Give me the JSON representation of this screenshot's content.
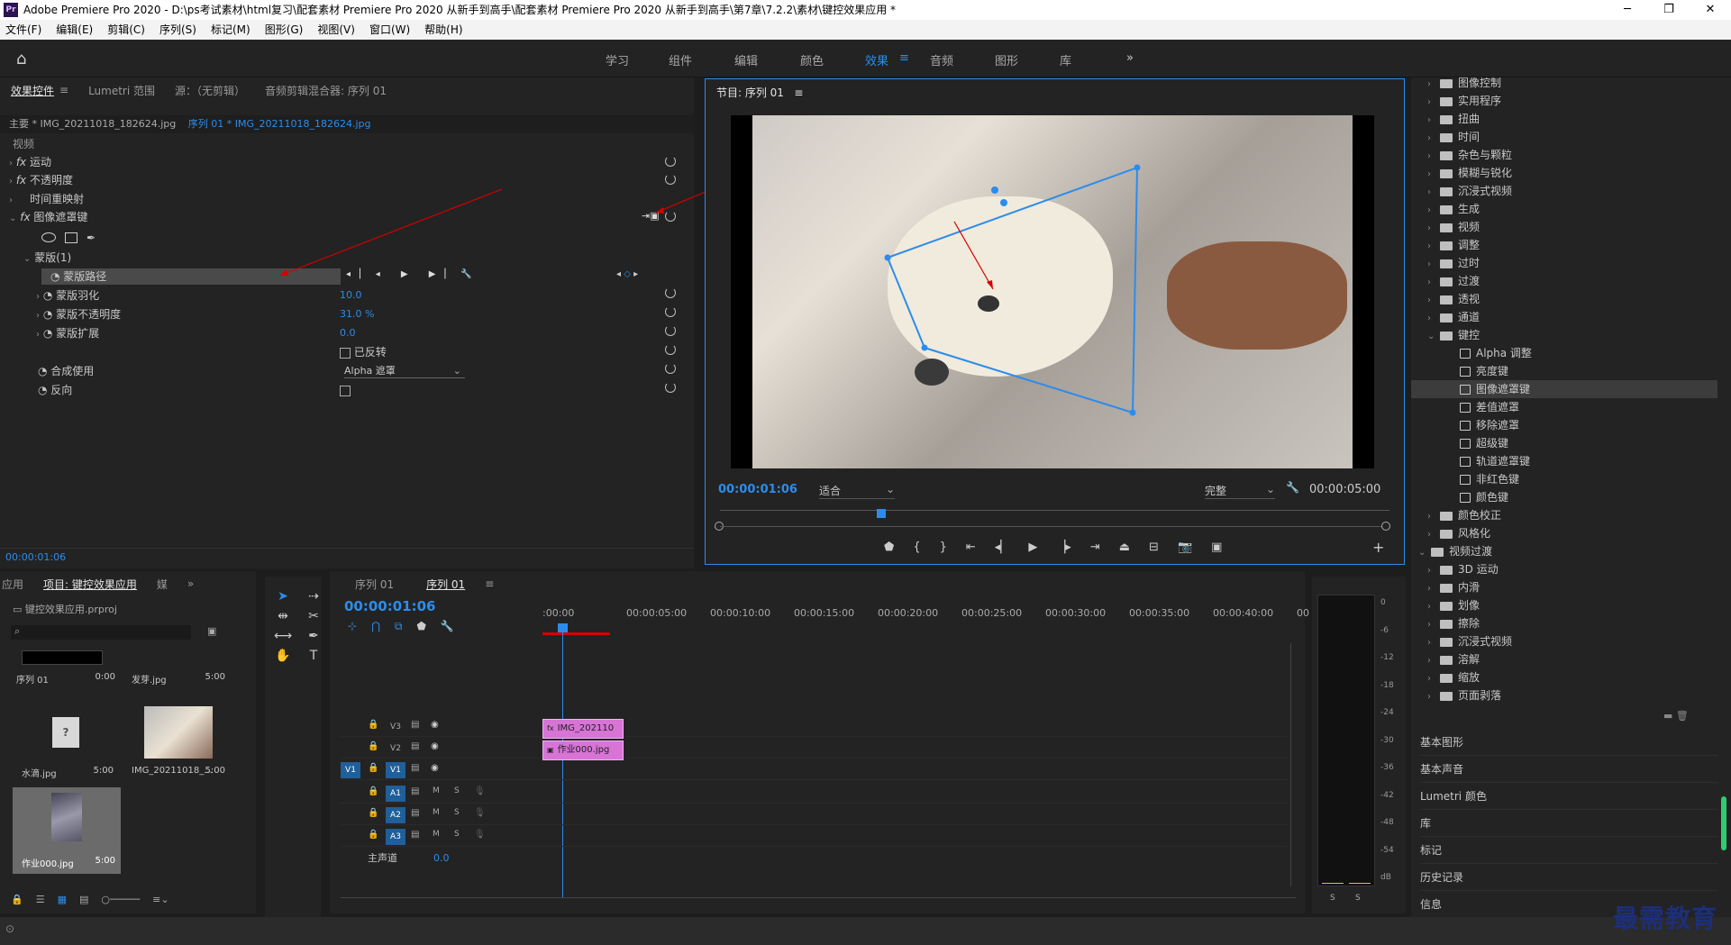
{
  "window": {
    "title": "Adobe Premiere Pro 2020 - D:\\ps考试素材\\html复习\\配套素材 Premiere Pro 2020 从新手到高手\\配套素材 Premiere Pro 2020 从新手到高手\\第7章\\7.2.2\\素材\\键控效果应用 *",
    "app_icon": "Pr",
    "minimize": "─",
    "maximize": "❐",
    "close": "✕"
  },
  "menu": [
    "文件(F)",
    "编辑(E)",
    "剪辑(C)",
    "序列(S)",
    "标记(M)",
    "图形(G)",
    "视图(V)",
    "窗口(W)",
    "帮助(H)"
  ],
  "workspaces": [
    "学习",
    "组件",
    "编辑",
    "颜色",
    "效果",
    "音频",
    "图形",
    "库"
  ],
  "active_workspace": "效果",
  "effect_controls": {
    "tabs": [
      "效果控件",
      "Lumetri 范围",
      "源：（无剪辑）",
      "音频剪辑混合器: 序列 01"
    ],
    "master": "主要 * IMG_20211018_182624.jpg",
    "sequence": "序列 01 * IMG_20211018_182624.jpg",
    "section": "视频",
    "rows": [
      "运动",
      "不透明度",
      "时间重映射",
      "图像遮罩键"
    ],
    "mask": "蒙版(1)",
    "mask_path": "蒙版路径",
    "mask_feather": "蒙版羽化",
    "feather_val": "10.0",
    "mask_opacity": "蒙版不透明度",
    "opacity_val": "31.0 %",
    "mask_expand": "蒙版扩展",
    "expand_val": "0.0",
    "inverted": "已反转",
    "composite": "合成使用",
    "composite_val": "Alpha 遮罩",
    "reverse": "反向",
    "timecode": "00:00:01:06"
  },
  "program": {
    "title": "节目: 序列 01",
    "timecode": "00:00:01:06",
    "fit": "适合",
    "quality": "完整",
    "duration": "00:00:05:00"
  },
  "effects_tree": {
    "items": [
      "图像控制",
      "实用程序",
      "扭曲",
      "时间",
      "杂色与颗粒",
      "模糊与锐化",
      "沉浸式视频",
      "生成",
      "视频",
      "调整",
      "过时",
      "过渡",
      "透视",
      "通道",
      "键控"
    ],
    "keying": [
      "Alpha 调整",
      "亮度键",
      "图像遮罩键",
      "差值遮罩",
      "移除遮罩",
      "超级键",
      "轨道遮罩键",
      "非红色键",
      "颜色键"
    ],
    "after": [
      "颜色校正",
      "风格化"
    ],
    "transitions": "视频过渡",
    "trans_items": [
      "3D 运动",
      "内滑",
      "划像",
      "擦除",
      "沉浸式视频",
      "溶解",
      "缩放",
      "页面剥落"
    ]
  },
  "right_bottom": [
    "基本图形",
    "基本声音",
    "Lumetri 颜色",
    "库",
    "标记",
    "历史记录",
    "信息"
  ],
  "project": {
    "tabs": [
      "应用",
      "项目: 键控效果应用",
      "媒"
    ],
    "file": "键控效果应用.prproj",
    "items": [
      {
        "name": "序列 01",
        "dur": "0:00"
      },
      {
        "name": "发芽.jpg",
        "dur": "5:00"
      },
      {
        "name": "水滴.jpg",
        "dur": "5:00"
      },
      {
        "name": "IMG_20211018_...",
        "dur": "5:00"
      },
      {
        "name": "作业000.jpg",
        "dur": "5:00"
      }
    ]
  },
  "timeline": {
    "tabs": [
      "序列 01",
      "序列 01"
    ],
    "timecode": "00:00:01:06",
    "ruler": [
      ":00:00",
      "00:00:05:00",
      "00:00:10:00",
      "00:00:15:00",
      "00:00:20:00",
      "00:00:25:00",
      "00:00:30:00",
      "00:00:35:00",
      "00:00:40:00",
      "00"
    ],
    "video_tracks": [
      "V3",
      "V2",
      "V1"
    ],
    "audio_tracks": [
      "A1",
      "A2",
      "A3"
    ],
    "master": "主声道",
    "master_val": "0.0",
    "clip_v2": "IMG_202110",
    "clip_v1": "作业000.jpg",
    "source_patch": "V1"
  },
  "vu": {
    "labels": [
      "0",
      "-6",
      "-12",
      "-18",
      "-24",
      "-30",
      "-36",
      "-42",
      "-48",
      "-54",
      "dB"
    ],
    "solo": [
      "S",
      "S"
    ]
  },
  "watermark": "最需教育",
  "colors": {
    "accent": "#2d8ceb",
    "clip": "#d774d6"
  }
}
